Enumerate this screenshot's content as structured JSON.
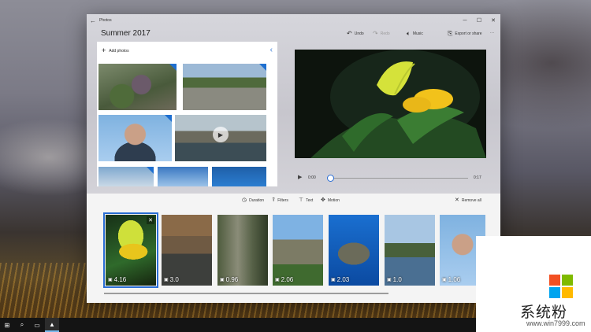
{
  "window": {
    "app_name": "Photos",
    "project_title": "Summer 2017"
  },
  "toolbar": {
    "undo_label": "Undo",
    "redo_label": "Redo",
    "music_label": "Music",
    "export_label": "Export or share",
    "more_glyph": "···"
  },
  "library": {
    "add_photos_label": "Add photos"
  },
  "playback": {
    "current_time": "0:00",
    "total_time": "0:17",
    "progress": 0.0
  },
  "storyboard": {
    "tools": {
      "duration": "Duration",
      "filters": "Filters",
      "text": "Text",
      "motion": "Motion",
      "remove_all": "Remove all"
    },
    "clips": [
      {
        "duration": "4.16",
        "selected": true
      },
      {
        "duration": "3.0"
      },
      {
        "duration": "0.96"
      },
      {
        "duration": "2.06"
      },
      {
        "duration": "2.03"
      },
      {
        "duration": "1.0"
      },
      {
        "duration": "1.06"
      }
    ]
  },
  "watermark": {
    "text": "系统粉",
    "url": "www.win7999.com"
  },
  "colors": {
    "accent": "#2a6dd4",
    "ms_red": "#f25022",
    "ms_green": "#7fba00",
    "ms_blue": "#00a4ef",
    "ms_yellow": "#ffb900"
  }
}
